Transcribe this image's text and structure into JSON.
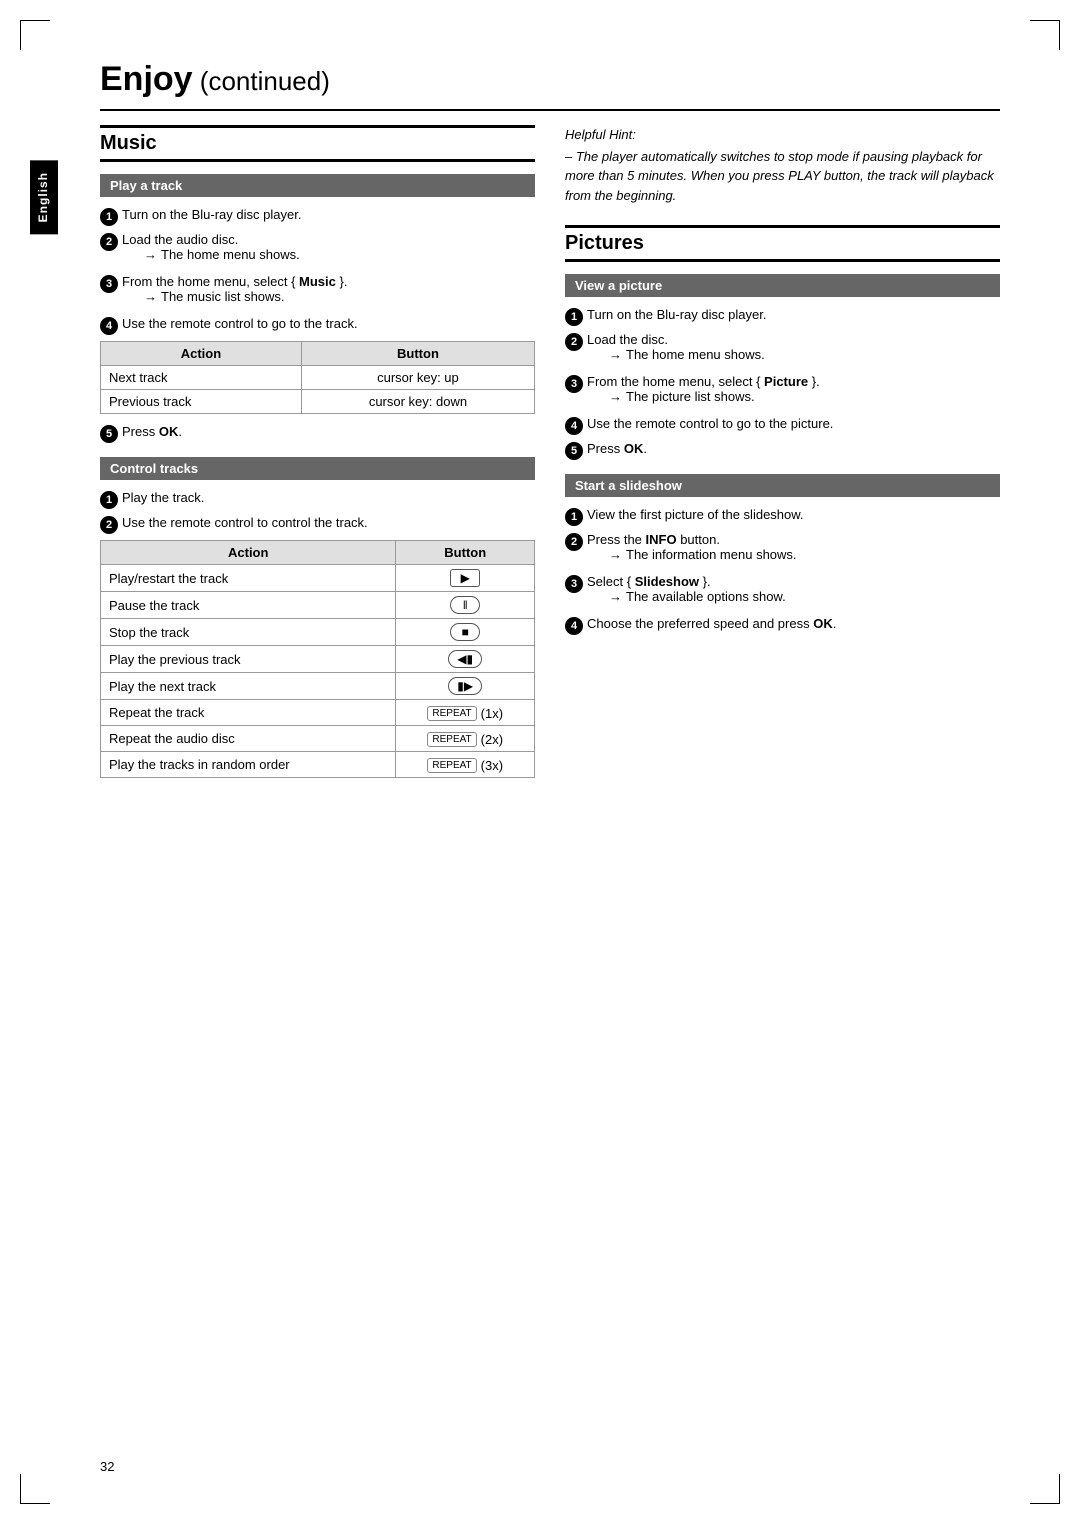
{
  "page": {
    "title": "Enjoy",
    "title_suffix": " (continued)",
    "page_number": "32",
    "sidebar_label": "English"
  },
  "left_section": {
    "title": "Music",
    "subsection1": {
      "header": "Play a track",
      "steps": [
        {
          "num": "1",
          "text": "Turn on the Blu-ray disc player."
        },
        {
          "num": "2",
          "text": "Load the audio disc.",
          "sub": "The home menu shows."
        },
        {
          "num": "3",
          "text_pre": "From the home menu, select { ",
          "bold": "Music",
          "text_post": " }.",
          "sub": "The music list shows."
        },
        {
          "num": "4",
          "text": "Use the remote control to go to the track."
        }
      ],
      "table": {
        "headers": [
          "Action",
          "Button"
        ],
        "rows": [
          {
            "action": "Next track",
            "button": "cursor key: up"
          },
          {
            "action": "Previous track",
            "button": "cursor key: down"
          }
        ]
      },
      "step5": "Press",
      "step5_bold": "OK",
      "step5_post": "."
    },
    "subsection2": {
      "header": "Control tracks",
      "steps": [
        {
          "num": "1",
          "text": "Play the track."
        },
        {
          "num": "2",
          "text": "Use the remote control to control the track."
        }
      ],
      "table": {
        "headers": [
          "Action",
          "Button"
        ],
        "rows": [
          {
            "action": "Play/restart the track",
            "button_type": "play"
          },
          {
            "action": "Pause the track",
            "button_type": "pause"
          },
          {
            "action": "Stop the track",
            "button_type": "stop"
          },
          {
            "action": "Play the previous track",
            "button_type": "prev"
          },
          {
            "action": "Play the next track",
            "button_type": "next"
          },
          {
            "action": "Repeat the track",
            "button_type": "repeat1x"
          },
          {
            "action": "Repeat the audio disc",
            "button_type": "repeat2x"
          },
          {
            "action": "Play the tracks in random order",
            "button_type": "repeat3x"
          }
        ]
      }
    }
  },
  "right_section": {
    "helpful_hint": {
      "title": "Helpful Hint:",
      "text": "– The player automatically switches to stop mode if pausing playback for more than 5 minutes.  When you press PLAY button, the track will playback from the beginning."
    },
    "pictures": {
      "title": "Pictures",
      "subsection1": {
        "header": "View a picture",
        "steps": [
          {
            "num": "1",
            "text": "Turn on the Blu-ray disc player."
          },
          {
            "num": "2",
            "text": "Load the disc.",
            "sub": "The home menu shows."
          },
          {
            "num": "3",
            "text_pre": "From the home menu, select { ",
            "bold": "Picture",
            "text_post": " }.",
            "sub": "The picture list shows."
          },
          {
            "num": "4",
            "text": "Use the remote control to go to the picture."
          }
        ],
        "step5": "Press",
        "step5_bold": "OK",
        "step5_post": "."
      },
      "subsection2": {
        "header": "Start a slideshow",
        "steps": [
          {
            "num": "1",
            "text": "View the first picture of the slideshow."
          },
          {
            "num": "2",
            "text_pre": "Press the ",
            "bold": "INFO",
            "text_post": " button.",
            "sub": "The information menu shows."
          },
          {
            "num": "3",
            "text_pre": "Select { ",
            "bold": "Slideshow",
            "text_post": " }.",
            "sub": "The available options show."
          },
          {
            "num": "4",
            "text_pre": "Choose the preferred speed and press ",
            "bold": "OK",
            "text_post": "."
          }
        ]
      }
    }
  }
}
